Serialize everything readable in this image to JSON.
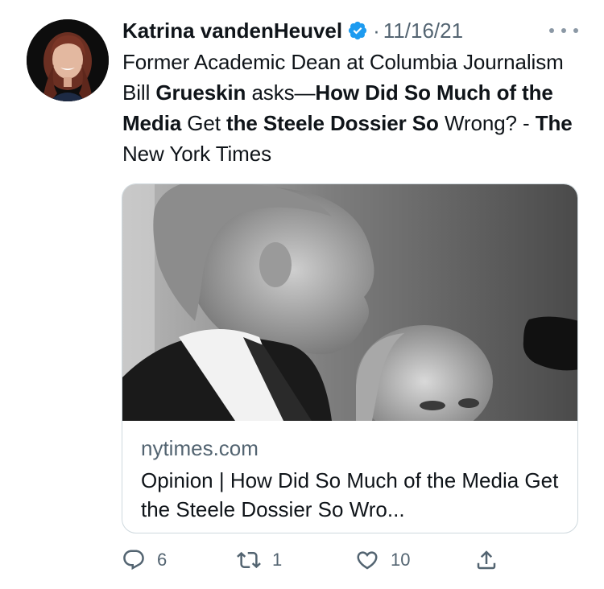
{
  "author": {
    "display_name": "Katrina vandenHeuvel",
    "verified": true,
    "separator": "·",
    "date": "11/16/21"
  },
  "icons": {
    "avatar": "profile-photo",
    "verified": "verified-badge-icon",
    "more": "more-options-icon",
    "reply": "reply-icon",
    "retweet": "retweet-icon",
    "like": "like-icon",
    "share": "share-icon"
  },
  "tweet": {
    "segments": [
      {
        "text": "Former Academic Dean at Columbia Journalism Bill ",
        "bold": false
      },
      {
        "text": "Grueskin",
        "bold": true
      },
      {
        "text": " asks—",
        "bold": false
      },
      {
        "text": "How Did So Much of the Media",
        "bold": true
      },
      {
        "text": " Get ",
        "bold": false
      },
      {
        "text": "the Steele Dossier So",
        "bold": true
      },
      {
        "text": " Wrong? - ",
        "bold": false
      },
      {
        "text": "The",
        "bold": true
      },
      {
        "text": " New York Times",
        "bold": false
      }
    ]
  },
  "card": {
    "domain": "nytimes.com",
    "title": "Opinion | How Did So Much of the Media Get the Steele Dossier So Wro..."
  },
  "actions": {
    "replies": "6",
    "retweets": "1",
    "likes": "10"
  },
  "colors": {
    "text": "#0f1419",
    "muted": "#536471",
    "verified": "#1d9bf0",
    "border": "#cfd9de"
  }
}
